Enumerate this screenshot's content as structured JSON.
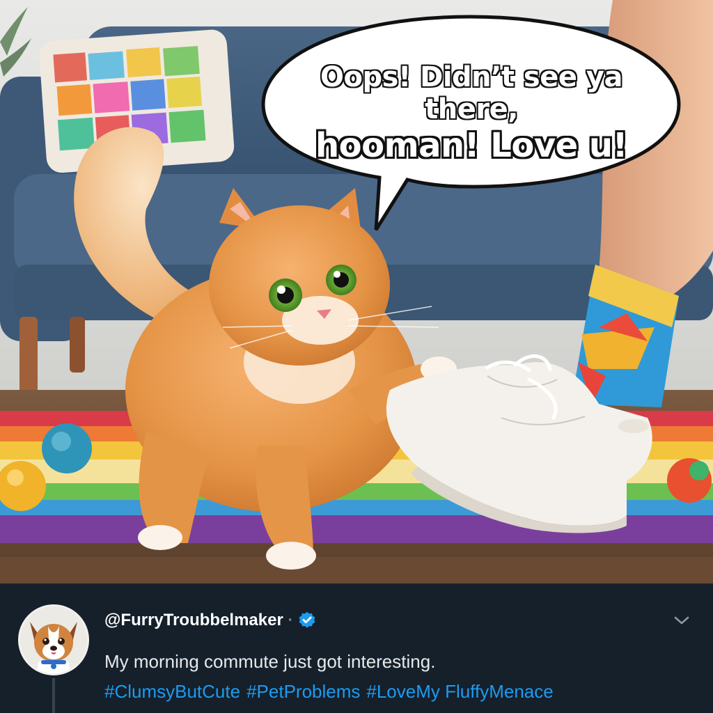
{
  "bubble": {
    "line1": "Oops! Didn’t see ya there,",
    "line2": "hooman! Love u!"
  },
  "tweet": {
    "handle": "@FurryTroubbelmaker",
    "separator": "·",
    "text": "My morning commute just got interesting.",
    "hashtags": [
      "#ClumsyButCute",
      "#PetProblems",
      "#LoveMy FluffyMenace"
    ]
  },
  "colors": {
    "background": "#15202b",
    "text": "#e7e9ea",
    "link": "#1d9bf0",
    "muted": "#8b98a5",
    "verified": "#1d9bf0"
  },
  "icons": {
    "verified": "verified-badge-icon",
    "more": "chevron-down-icon"
  }
}
